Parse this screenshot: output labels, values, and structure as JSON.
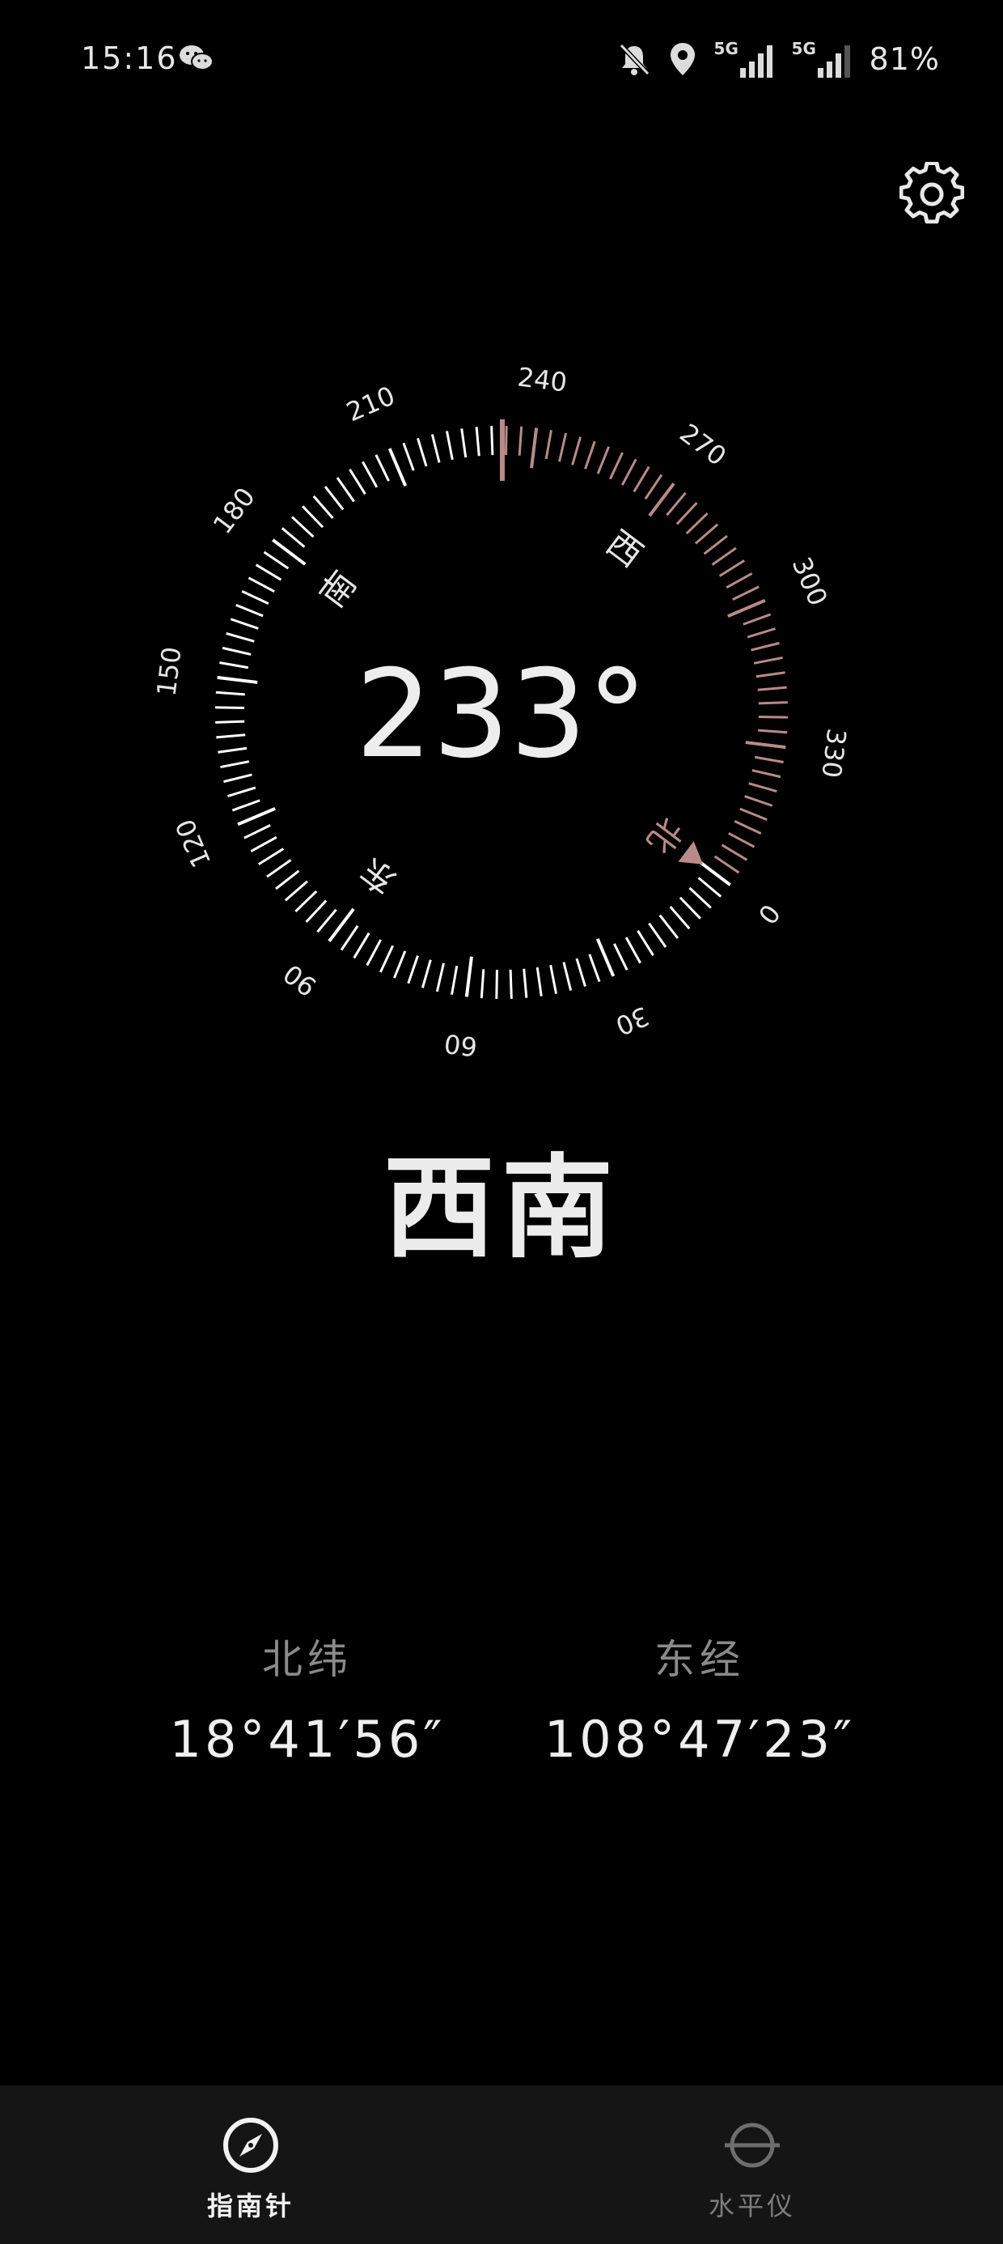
{
  "status_bar": {
    "time": "15:16",
    "battery": "81%",
    "network1": "5G",
    "network2": "5G",
    "icons": [
      "wechat-icon",
      "bell-muted-icon",
      "location-icon",
      "signal-icon",
      "signal-icon"
    ]
  },
  "compass": {
    "heading": "233°",
    "direction": "西南",
    "degree_labels": [
      "0",
      "30",
      "60",
      "90",
      "120",
      "150",
      "180",
      "210",
      "240",
      "270",
      "300",
      "330"
    ],
    "cardinals": {
      "north": "北",
      "east": "东",
      "south": "南",
      "west": "西"
    },
    "accent_color": "#b88a8a",
    "tick_color": "#ffffff"
  },
  "location": {
    "lat_label": "北纬",
    "lat_value": "18°41′56″",
    "lon_label": "东经",
    "lon_value": "108°47′23″"
  },
  "nav": {
    "compass_label": "指南针",
    "level_label": "水平仪"
  }
}
